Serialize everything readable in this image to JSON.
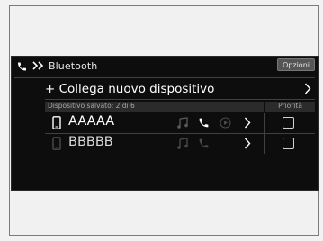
{
  "header": {
    "title": "Bluetooth",
    "options_label": "Opzioni"
  },
  "add_device": {
    "label": "+ Collega nuovo dispositivo"
  },
  "table": {
    "saved_label": "Dispositivo salvato: 2 di 6",
    "priority_label": "Priorità"
  },
  "devices": [
    {
      "name": "AAAAA",
      "connected": true
    },
    {
      "name": "BBBBB",
      "connected": false
    }
  ],
  "colors": {
    "screen_bg": "#0d0d0d",
    "text_primary": "#ffffff",
    "icon_dim": "#5a5a5a",
    "icon_bright": "#ffffff",
    "header_band": "#2b2b2b"
  },
  "icons": {
    "header_phone": "phone-icon",
    "header_chevrons": "double-chevron-icon",
    "device": "smartphone-icon",
    "audio": "music-note-icon",
    "call": "phone-icon",
    "play": "play-circle-icon",
    "more": "chevron-right-icon"
  }
}
